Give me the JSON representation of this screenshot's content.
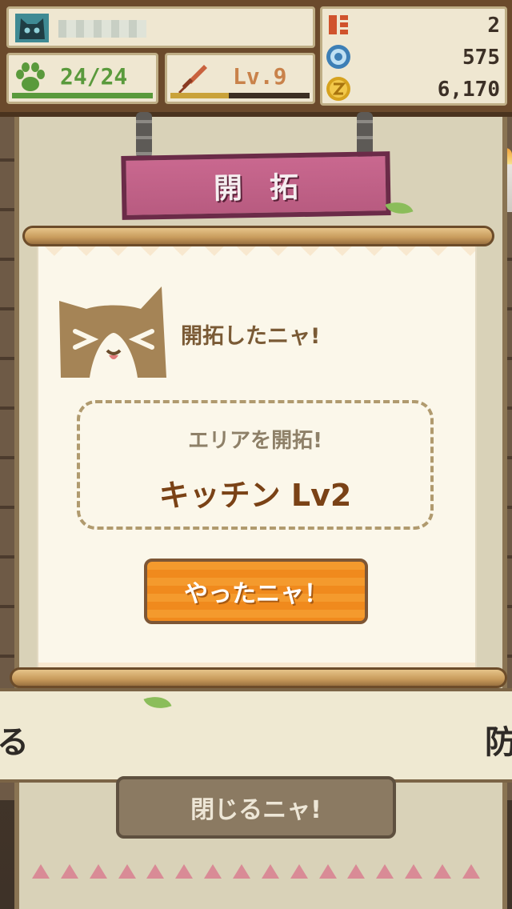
{
  "hud": {
    "stamina": "24/24",
    "stamina_ratio": 1.0,
    "level": "Lv.9",
    "exp_ratio": 0.42,
    "currencies": [
      {
        "icon": "ticket-icon",
        "value": "2"
      },
      {
        "icon": "blue-medal-icon",
        "value": "575"
      },
      {
        "icon": "gold-coin-icon",
        "value": "6,170"
      }
    ],
    "colors": {
      "stamina": "#5a9a3c",
      "exp": "#c9a23a",
      "level": "#c9824a"
    }
  },
  "sign": {
    "title": "開拓"
  },
  "dialog": {
    "headline": "開拓したニャ!",
    "result_subtitle": "エリアを開拓!",
    "result_main": "キッチン Lv2",
    "confirm_label": "やったニャ！"
  },
  "background": {
    "close_label": "閉じるニャ!",
    "left_char": "る",
    "right_char": "防"
  },
  "accent_colors": {
    "sign": "#c9688f",
    "button": "#f08a1d",
    "result_text": "#7a4216"
  }
}
